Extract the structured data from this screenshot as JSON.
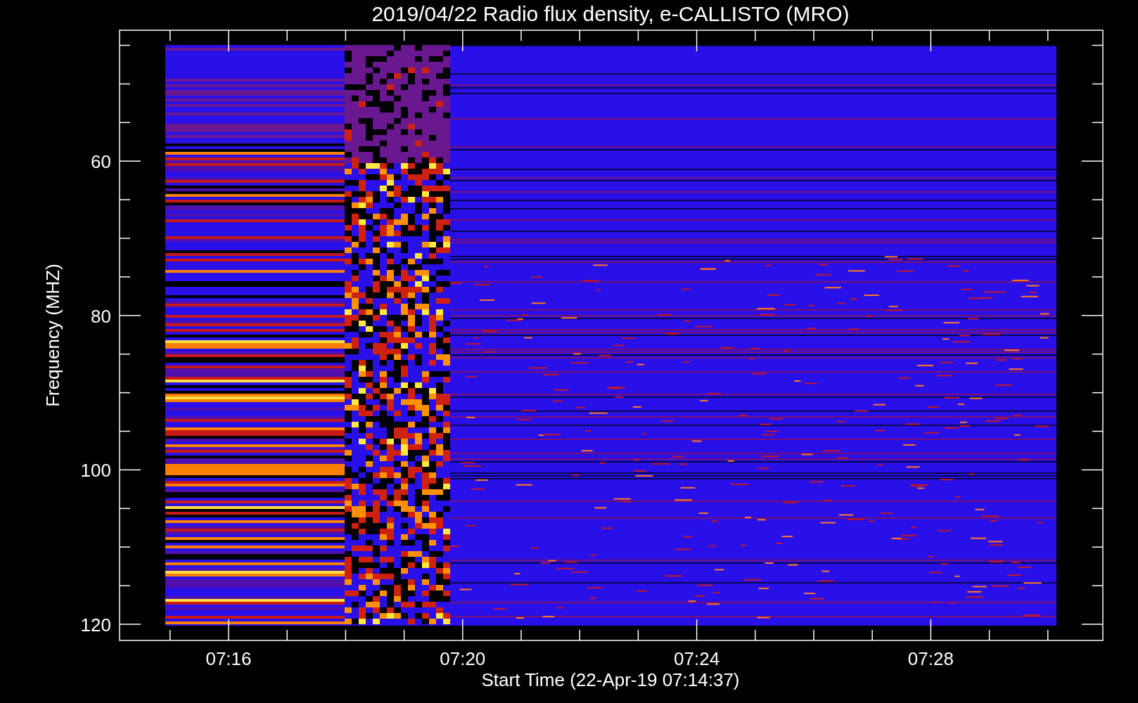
{
  "title": "2019/04/22  Radio flux density, e-CALLISTO (MRO)",
  "y_axis": {
    "label": "Frequency (MHZ)",
    "ticks": [
      "60",
      "80",
      "100",
      "120"
    ]
  },
  "x_axis": {
    "label": "Start Time (22-Apr-19 07:14:37)",
    "ticks": [
      "07:16",
      "07:20",
      "07:24",
      "07:28"
    ]
  }
}
